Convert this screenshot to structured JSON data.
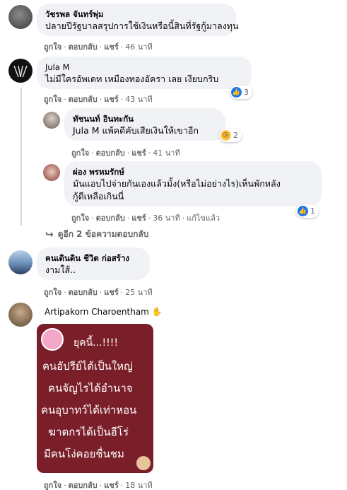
{
  "comments": [
    {
      "name": "วัชรพล จันทร์พุ่ม",
      "text": "ปลายปีรัฐบาลสรุปการใช้เงินหรือนี้สินที่รัฐกู้มาลงทุน",
      "like": "ถูกใจ",
      "reply": "ตอบกลับ",
      "share": "แชร์",
      "time": "46 นาที"
    },
    {
      "name": "Jula M",
      "text": "ไม่มีใครอัพเดท เหมืองทองอัครา เลย เงียบกริบ",
      "like": "ถูกใจ",
      "reply": "ตอบกลับ",
      "share": "แชร์",
      "time": "43 นาที",
      "reaction_count": "3"
    },
    {
      "name": "ทัชนนท์ อินทะกัน",
      "text": "Jula M แพ้คดีคับเสียเงินให้เขาอีก",
      "like": "ถูกใจ",
      "reply": "ตอบกลับ",
      "share": "แชร์",
      "time": "41 นาที",
      "reaction_count": "2"
    },
    {
      "name": "ผ่อง พรหมรักษ์",
      "text_line1": "มันแอบไปจ่ายกันเองแล้วมั้ง(หรือไม่อย่างไร)เห็นพักหลัง",
      "text_line2": "กู้ดีเหลือเกินนี่",
      "like": "ถูกใจ",
      "reply": "ตอบกลับ",
      "share": "แชร์",
      "time": "36 นาที",
      "edited": "แก้ไขแล้ว",
      "reaction_count": "1"
    },
    {
      "name": "คนเดินดิน ชีวิต ก่อสร้าง",
      "text": "งามใส้..",
      "like": "ถูกใจ",
      "reply": "ตอบกลับ",
      "share": "แชร์",
      "time": "25 นาที"
    },
    {
      "name": "Artipakorn Charoentham",
      "like": "ถูกใจ",
      "reply": "ตอบกลับ",
      "share": "แชร์",
      "time": "18 นาที"
    }
  ],
  "more_replies": "ดูอีก 2 ข้อความตอบกลับ",
  "poster": {
    "lines": [
      "ยุคนี้...!!!!",
      "คนอัปรีย์ได้เป็นใหญ่",
      "คนจัญไรได้อำนาจ",
      "คนอุบาทว์ได้เท่าหอน",
      "ฆาตกรได้เป็นฮีโร่",
      "มีคนโง่คอยชื่นชม"
    ],
    "background": "#7a1f2a"
  },
  "colors": {
    "like_blue": "#1877f2",
    "bubble": "#f0f2f5",
    "meta": "#65676b"
  }
}
